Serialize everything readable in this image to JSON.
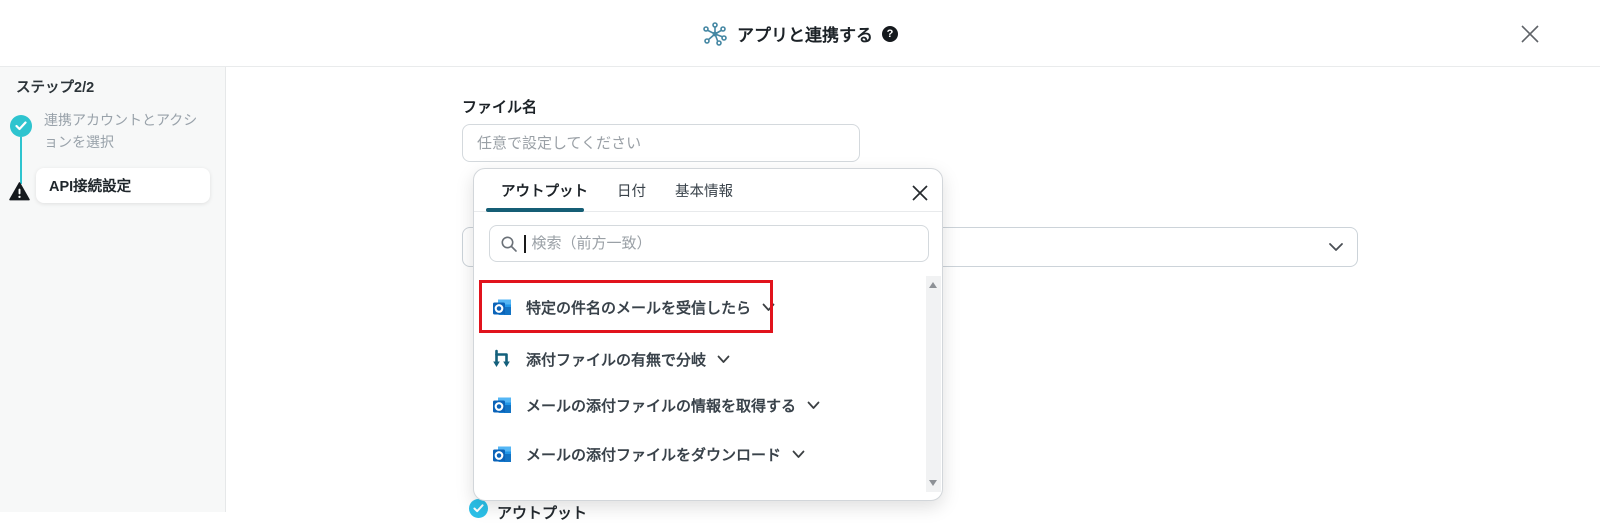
{
  "header": {
    "title": "アプリと連携する",
    "help_icon": "question-circle",
    "app_icon": "integration-network",
    "close_icon": "x"
  },
  "sidebar": {
    "step_header": "ステップ2/2",
    "steps": [
      {
        "label": "連携アカウントとアクションを選択",
        "status": "done"
      },
      {
        "label": "API接続設定",
        "status": "warning"
      }
    ]
  },
  "main": {
    "file_name_label": "ファイル名",
    "file_name_placeholder": "任意で設定してください",
    "output_select_value": ""
  },
  "popup": {
    "tabs": [
      {
        "label": "アウトプット",
        "active": true
      },
      {
        "label": "日付",
        "active": false
      },
      {
        "label": "基本情報",
        "active": false
      }
    ],
    "search_placeholder": "検索（前方一致）",
    "items": [
      {
        "icon": "outlook",
        "label": "特定の件名のメールを受信したら",
        "highlighted": true
      },
      {
        "icon": "branch",
        "label": "添付ファイルの有無で分岐",
        "highlighted": false
      },
      {
        "icon": "outlook",
        "label": "メールの添付ファイルの情報を取得する",
        "highlighted": false
      },
      {
        "icon": "outlook",
        "label": "メールの添付ファイルをダウンロード",
        "highlighted": false
      }
    ]
  },
  "below_section": {
    "label": "アウトプット"
  },
  "colors": {
    "accent_teal": "#2ec4cf",
    "dark_teal": "#155e75",
    "highlight_red": "#e1131c",
    "outlook_blue": "#0b63b8"
  }
}
